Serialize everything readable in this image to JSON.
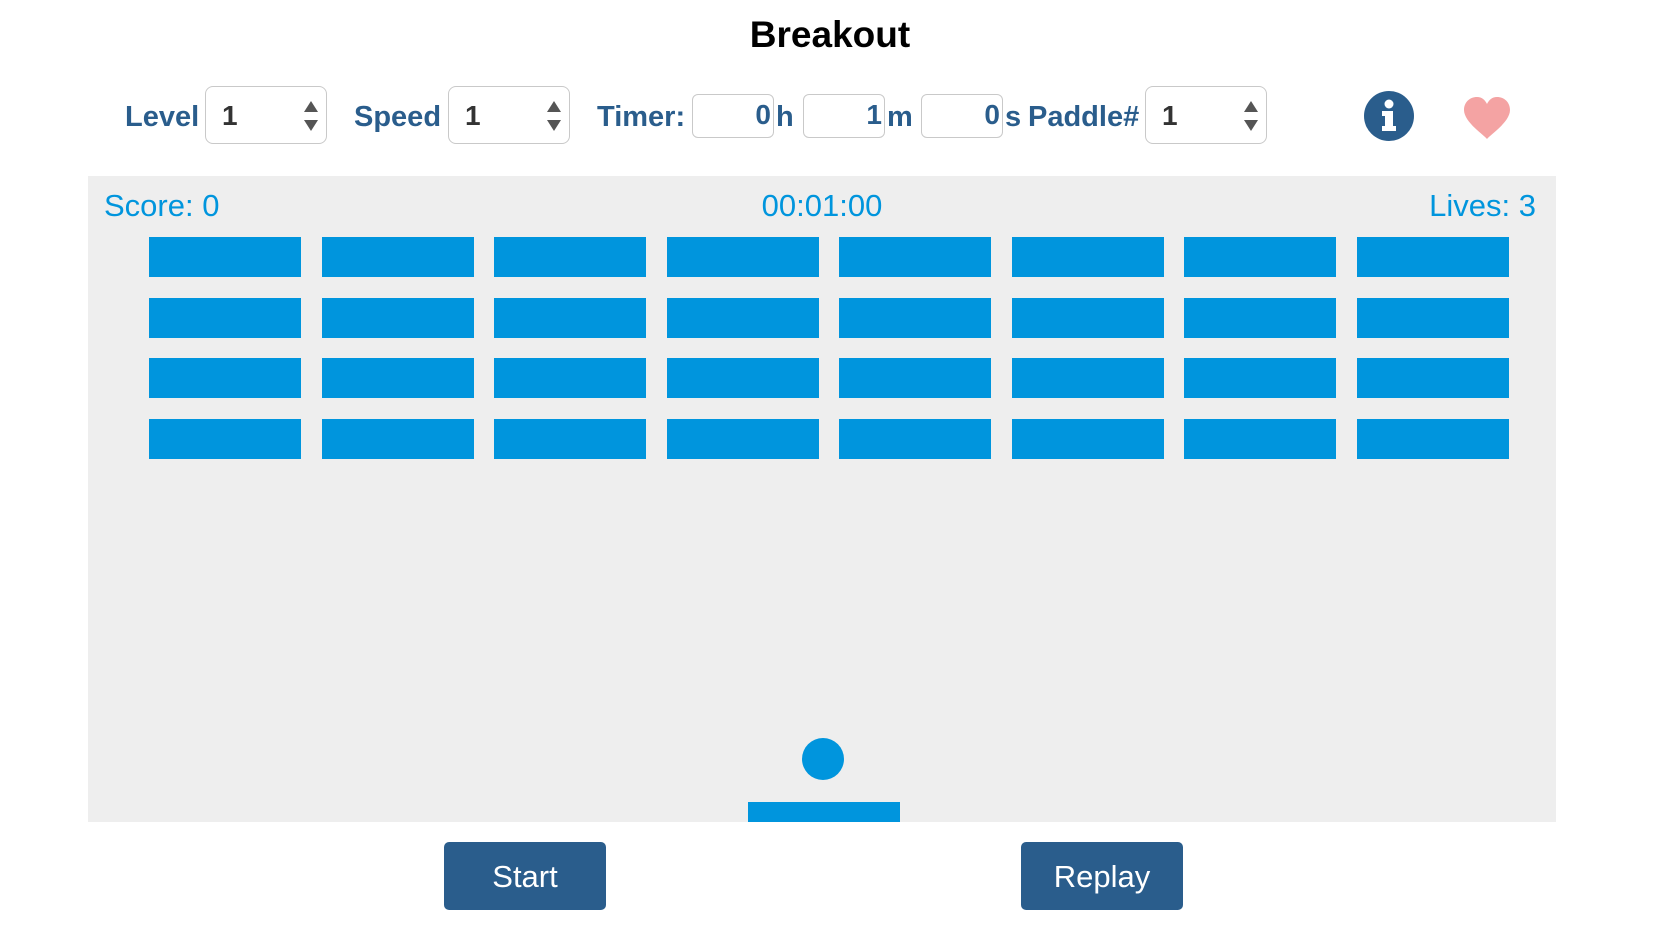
{
  "title": "Breakout",
  "controls": {
    "level_label": "Level",
    "level_value": "1",
    "speed_label": "Speed",
    "speed_value": "1",
    "timer_label": "Timer:",
    "timer_hours": "0",
    "hours_unit": "h",
    "timer_minutes": "1",
    "minutes_unit": "m",
    "timer_seconds": "0",
    "seconds_unit": "s",
    "paddle_label": "Paddle#",
    "paddle_value": "1"
  },
  "icons": {
    "info": "info-icon",
    "heart": "heart-icon"
  },
  "game": {
    "score_text": "Score: 0",
    "timer_text": "00:01:00",
    "lives_text": "Lives: 3",
    "brick_rows": 4,
    "brick_columns": 8
  },
  "buttons": {
    "start": "Start",
    "replay": "Replay"
  },
  "colors": {
    "accent": "#2a5d8c",
    "game_blue": "#0095dd",
    "heart": "#f4a3a3",
    "game_background": "#eeeeee"
  }
}
